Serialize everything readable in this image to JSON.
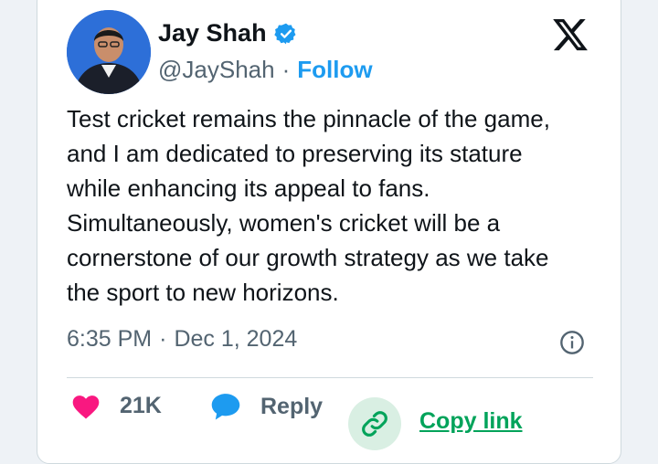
{
  "tweet": {
    "author": {
      "name": "Jay Shah",
      "handle": "@JayShah",
      "separator": "·",
      "follow_label": "Follow"
    },
    "text_lines": [
      "Test cricket remains the pinnacle of the game,",
      "and I am dedicated to preserving its stature",
      "while enhancing its appeal to fans.",
      "Simultaneously, women's cricket will be a",
      "cornerstone of our growth strategy as we take",
      "the sport to new horizons."
    ],
    "time": "6:35 PM",
    "meta_separator": "·",
    "date": "Dec 1, 2024",
    "actions": {
      "like_count": "21K",
      "reply_label": "Reply",
      "copy_label": "Copy link"
    }
  },
  "icons": [
    "verified-badge-icon",
    "x-logo-icon",
    "info-icon",
    "heart-icon",
    "reply-bubble-icon",
    "link-icon"
  ],
  "colors": {
    "background": "#eef2f6",
    "card": "#ffffff",
    "text": "#0f1419",
    "muted": "#536471",
    "follow": "#1d9bf0",
    "like": "#f91880",
    "reply": "#1d9bf0",
    "copy": "#00a35a"
  }
}
